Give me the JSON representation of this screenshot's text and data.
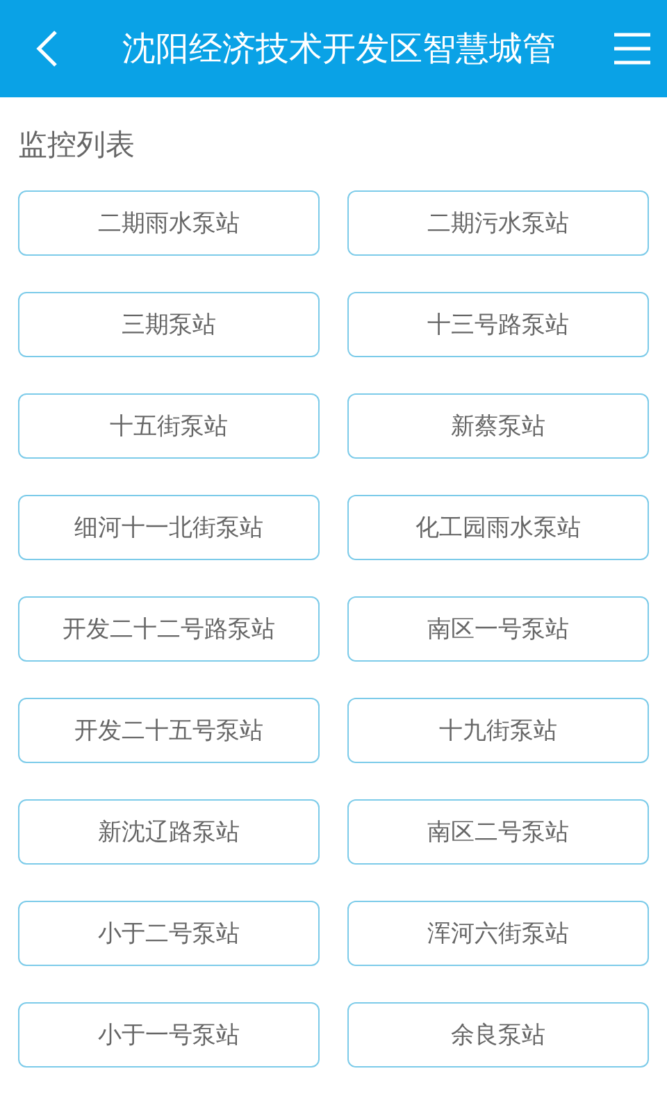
{
  "header": {
    "title": "沈阳经济技术开发区智慧城管"
  },
  "section_title": "监控列表",
  "stations": [
    "二期雨水泵站",
    "二期污水泵站",
    "三期泵站",
    "十三号路泵站",
    "十五街泵站",
    "新蔡泵站",
    "细河十一北街泵站",
    "化工园雨水泵站",
    "开发二十二号路泵站",
    "南区一号泵站",
    "开发二十五号泵站",
    "十九街泵站",
    "新沈辽路泵站",
    "南区二号泵站",
    "小于二号泵站",
    "浑河六街泵站",
    "小于一号泵站",
    "余良泵站"
  ]
}
